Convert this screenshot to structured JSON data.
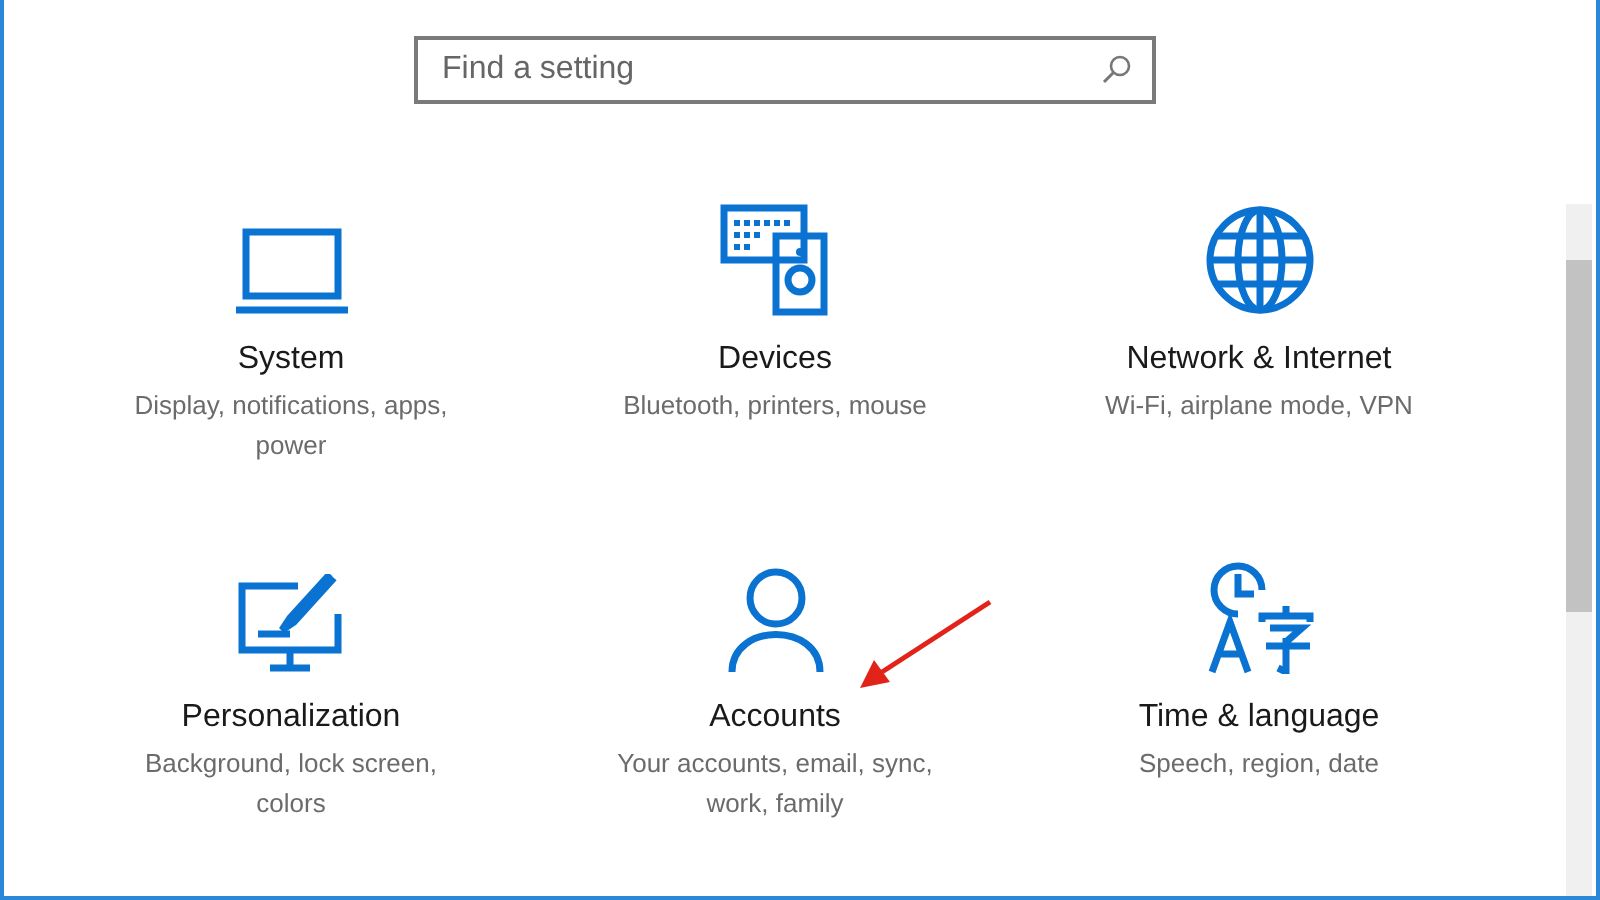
{
  "search": {
    "placeholder": "Find a setting"
  },
  "categories": [
    {
      "kind": "laptop",
      "title": "System",
      "description": "Display, notifications, apps, power"
    },
    {
      "kind": "devices",
      "title": "Devices",
      "description": "Bluetooth, printers, mouse"
    },
    {
      "kind": "globe",
      "title": "Network & Internet",
      "description": "Wi-Fi, airplane mode, VPN"
    },
    {
      "kind": "paint",
      "title": "Personalization",
      "description": "Background, lock screen, colors"
    },
    {
      "kind": "person",
      "title": "Accounts",
      "description": "Your accounts, email, sync, work, family"
    },
    {
      "kind": "language",
      "title": "Time & language",
      "description": "Speech, region, date"
    }
  ]
}
